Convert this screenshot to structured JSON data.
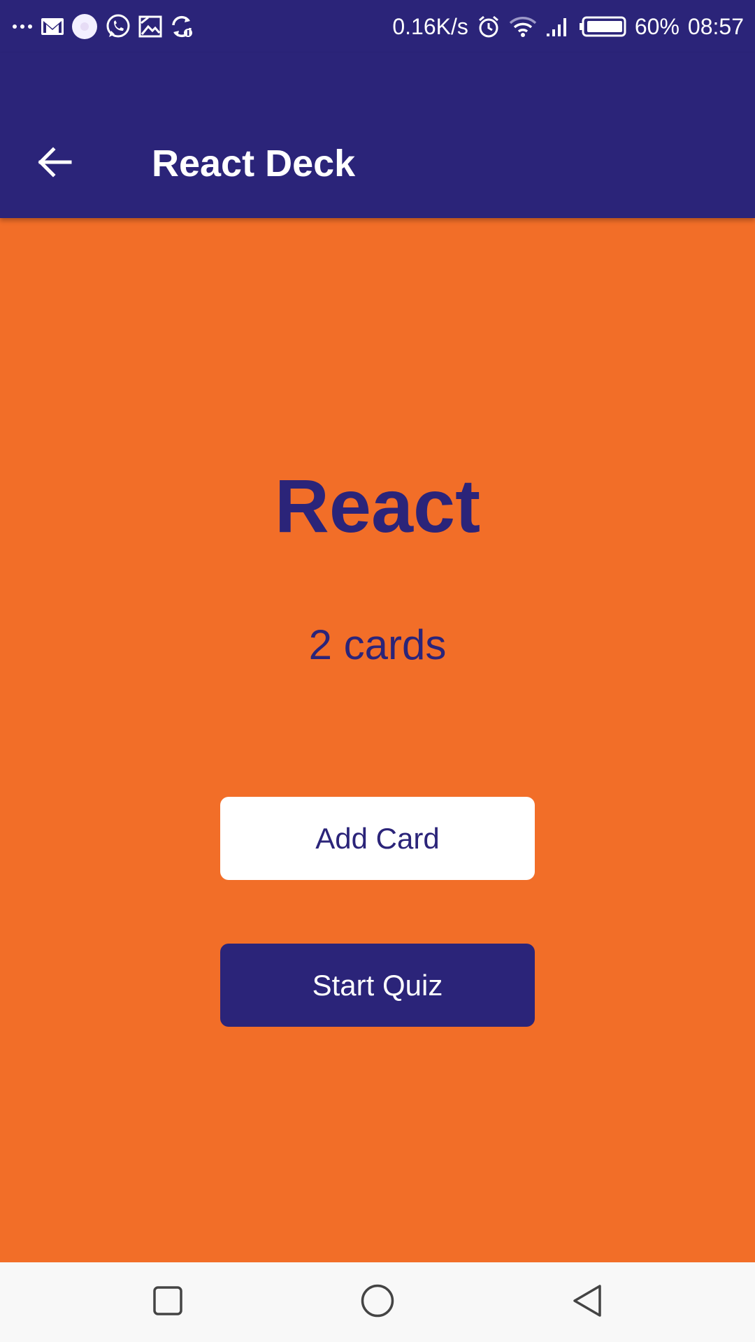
{
  "status_bar": {
    "net_speed": "0.16K/s",
    "battery_percent": "60%",
    "time": "08:57",
    "left_icons": [
      "more-icon",
      "gmail-icon",
      "app-circle-icon",
      "whatsapp-icon",
      "gallery-icon",
      "sync-icon"
    ],
    "right_icons": [
      "alarm-icon",
      "wifi-icon",
      "signal-icon",
      "battery-icon"
    ]
  },
  "app_bar": {
    "title": "React Deck",
    "back_icon": "arrow-left-icon"
  },
  "deck": {
    "title": "React",
    "card_count": "2 cards"
  },
  "actions": {
    "add_card_label": "Add Card",
    "start_quiz_label": "Start Quiz"
  },
  "nav_bar": {
    "icons": [
      "recents-square-icon",
      "home-circle-icon",
      "back-triangle-icon"
    ]
  },
  "colors": {
    "primary": "#2b2479",
    "accent_background": "#f26e28",
    "light": "#ffffff",
    "nav_background": "#f8f8f8"
  }
}
